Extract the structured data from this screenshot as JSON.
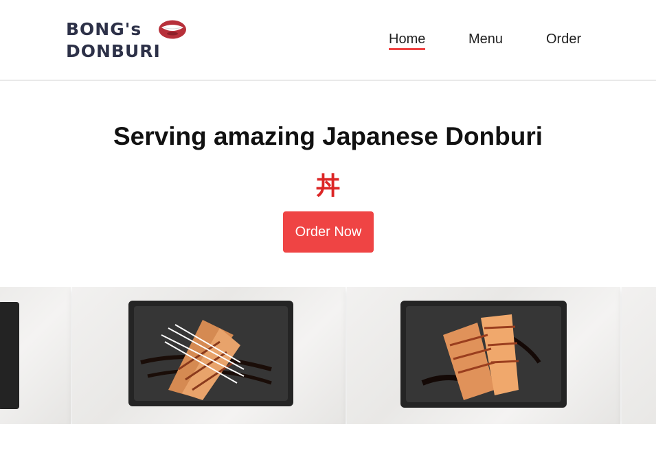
{
  "brand": {
    "line1": "BONG's",
    "line2": "DONBURI",
    "logo_icon": "mouth-icon",
    "accent": "#ef4444",
    "text_color": "#2d3148"
  },
  "nav": {
    "items": [
      {
        "label": "Home",
        "active": true
      },
      {
        "label": "Menu",
        "active": false
      },
      {
        "label": "Order",
        "active": false
      }
    ]
  },
  "hero": {
    "title": "Serving amazing Japanese Donburi",
    "kanji": "丼",
    "cta_label": "Order Now"
  },
  "gallery": {
    "images": [
      {
        "name": "partial-plate-left"
      },
      {
        "name": "grilled-eel-with-radish"
      },
      {
        "name": "grilled-eel-with-sauce"
      },
      {
        "name": "partial-plate-right"
      }
    ]
  }
}
